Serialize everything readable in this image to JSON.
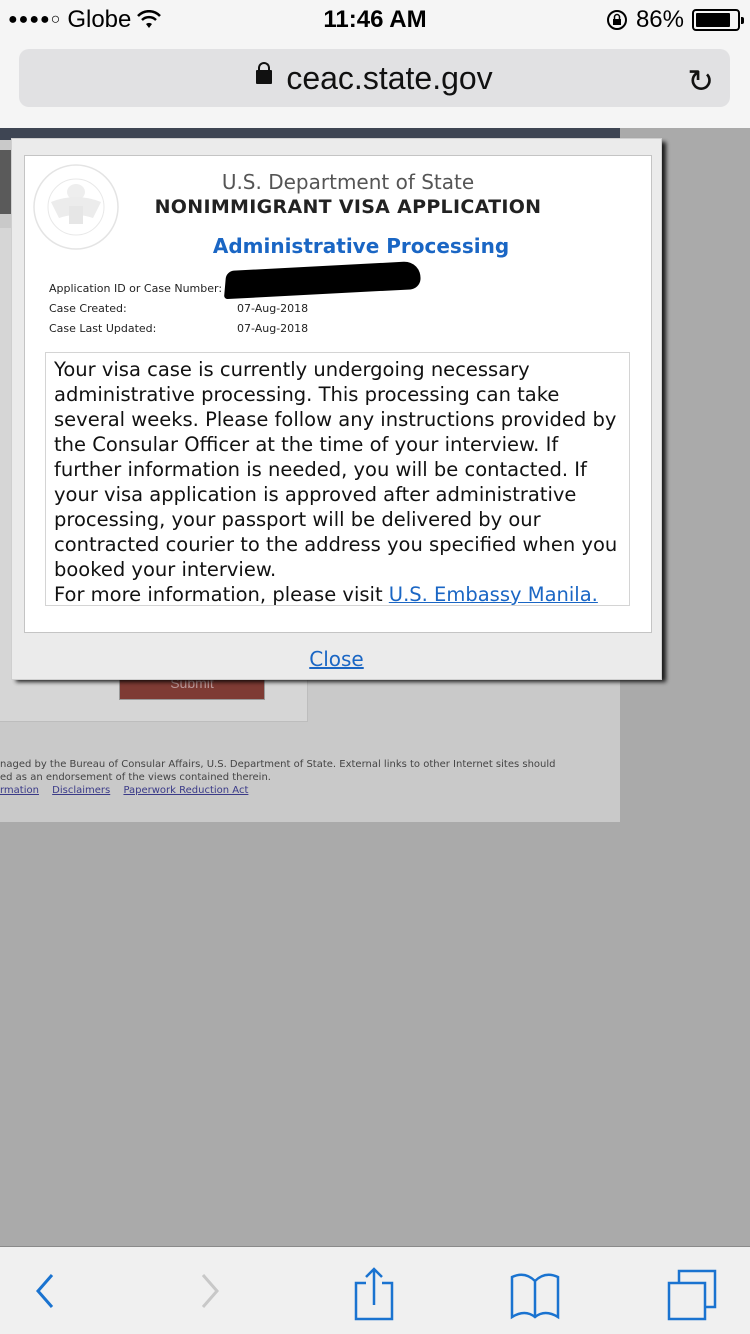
{
  "status_bar": {
    "carrier": "Globe",
    "signal_dots": "●●●●○",
    "time": "11:46 AM",
    "battery_percent": "86%",
    "battery_level": 0.86
  },
  "browser": {
    "url": "ceac.state.gov",
    "icons": [
      "lock-icon",
      "reload-icon"
    ]
  },
  "background_page": {
    "submit_label": "Submit",
    "footer_line1": "naged by the Bureau of Consular Affairs, U.S. Department of State. External links to other Internet sites should",
    "footer_line2": "ed as an endorsement of the views contained therein.",
    "footer_links": [
      "rmation",
      "Disclaimers",
      "Paperwork Reduction Act"
    ]
  },
  "modal": {
    "department": "U.S. Department of State",
    "app_title": "NONIMMIGRANT VISA APPLICATION",
    "status_title": "Administrative Processing",
    "fields": [
      {
        "label": "Application ID or Case Number:",
        "value": ""
      },
      {
        "label": "Case Created:",
        "value": "07-Aug-2018"
      },
      {
        "label": "Case Last Updated:",
        "value": "07-Aug-2018"
      }
    ],
    "message": "Your visa case is currently undergoing necessary administrative processing. This processing can take several weeks. Please follow any instructions provided by the Consular Officer at the time of your interview. If further information is needed, you will be contacted. If your visa application is approved after administrative processing, your passport will be delivered by our contracted courier to the address you specified when you booked your interview.",
    "more_info_prefix": "For more information, please visit ",
    "more_info_link": "U.S. Embassy Manila.",
    "close_label": "Close",
    "accent_color": "#1a66c4"
  },
  "toolbar": {
    "items": [
      "back",
      "forward",
      "share",
      "bookmarks",
      "tabs"
    ]
  }
}
